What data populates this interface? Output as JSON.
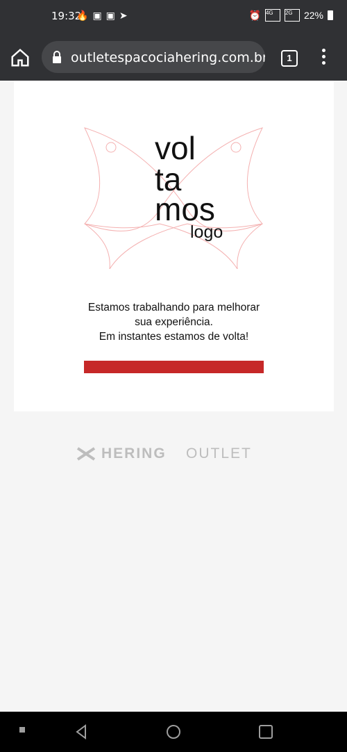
{
  "status_bar": {
    "time": "19:32",
    "battery": "22%",
    "net1": "4G",
    "net2": "2G"
  },
  "browser": {
    "url": "outletespacociahering.com.br/",
    "tab_count": "1"
  },
  "page": {
    "logo_lines": [
      "vol",
      "ta",
      "mos",
      "logo"
    ],
    "message_lines": [
      "Estamos trabalhando para melhorar",
      "sua experiência.",
      "Em instantes estamos de volta!"
    ],
    "progress": 1.0,
    "footer_brand": "HERING",
    "footer_suffix": "OUTLET"
  },
  "colors": {
    "accent": "#c62828",
    "chrome": "#303134"
  }
}
